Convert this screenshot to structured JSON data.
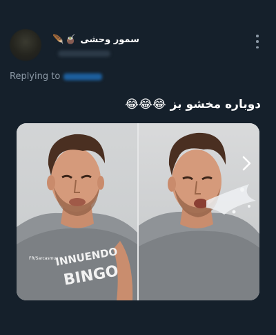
{
  "tweet": {
    "display_name": "سمور وحشی",
    "name_emojis": [
      "🪶",
      "🧉"
    ],
    "replying_label": "Replying to",
    "text": "دوباره مخشو بز 😂😂😂"
  },
  "media": {
    "watermark": "FR/Sarcasmus",
    "shirt_line_1": "INNUENDO",
    "shirt_line_2": "BINGO",
    "next_icon": "chevron-right-icon"
  },
  "colors": {
    "background": "#15202b",
    "secondary_text": "#8b98a5",
    "mention_blue": "#1d9bf0"
  }
}
